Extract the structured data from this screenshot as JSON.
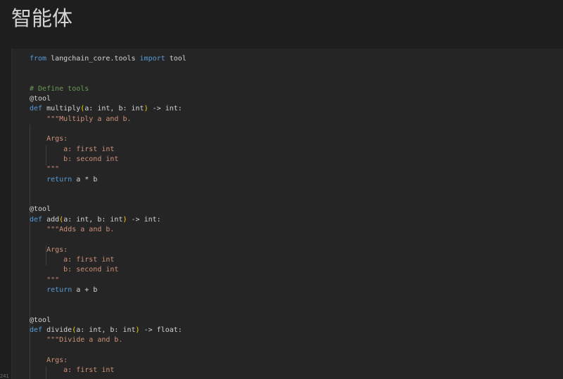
{
  "page": {
    "title": "智能体",
    "gutter_number": "241"
  },
  "code_cell": {
    "language": "python",
    "lines": [
      [
        {
          "t": "kw",
          "v": "from"
        },
        {
          "t": "tx",
          "v": " langchain_core.tools "
        },
        {
          "t": "kw",
          "v": "import"
        },
        {
          "t": "tx",
          "v": " tool"
        }
      ],
      [],
      [],
      [
        {
          "t": "cm",
          "v": "# Define tools"
        }
      ],
      [
        {
          "t": "tx",
          "v": "@tool"
        }
      ],
      [
        {
          "t": "kw",
          "v": "def"
        },
        {
          "t": "tx",
          "v": " multiply"
        },
        {
          "t": "pr",
          "v": "("
        },
        {
          "t": "tx",
          "v": "a: int, b: int"
        },
        {
          "t": "pr",
          "v": ")"
        },
        {
          "t": "tx",
          "v": " -> int:"
        }
      ],
      [
        {
          "t": "tx",
          "v": "    "
        },
        {
          "t": "st",
          "v": "\"\"\"Multiply a and b."
        }
      ],
      [],
      [
        {
          "t": "st",
          "v": "    Args:"
        }
      ],
      [
        {
          "t": "st",
          "v": "        a: first int"
        }
      ],
      [
        {
          "t": "st",
          "v": "        b: second int"
        }
      ],
      [
        {
          "t": "st",
          "v": "    \"\"\""
        }
      ],
      [
        {
          "t": "tx",
          "v": "    "
        },
        {
          "t": "kw",
          "v": "return"
        },
        {
          "t": "tx",
          "v": " a * b"
        }
      ],
      [],
      [],
      [
        {
          "t": "tx",
          "v": "@tool"
        }
      ],
      [
        {
          "t": "kw",
          "v": "def"
        },
        {
          "t": "tx",
          "v": " add"
        },
        {
          "t": "pr",
          "v": "("
        },
        {
          "t": "tx",
          "v": "a: int, b: int"
        },
        {
          "t": "pr",
          "v": ")"
        },
        {
          "t": "tx",
          "v": " -> int:"
        }
      ],
      [
        {
          "t": "tx",
          "v": "    "
        },
        {
          "t": "st",
          "v": "\"\"\"Adds a and b."
        }
      ],
      [],
      [
        {
          "t": "st",
          "v": "    Args:"
        }
      ],
      [
        {
          "t": "st",
          "v": "        a: first int"
        }
      ],
      [
        {
          "t": "st",
          "v": "        b: second int"
        }
      ],
      [
        {
          "t": "st",
          "v": "    \"\"\""
        }
      ],
      [
        {
          "t": "tx",
          "v": "    "
        },
        {
          "t": "kw",
          "v": "return"
        },
        {
          "t": "tx",
          "v": " a + b"
        }
      ],
      [],
      [],
      [
        {
          "t": "tx",
          "v": "@tool"
        }
      ],
      [
        {
          "t": "kw",
          "v": "def"
        },
        {
          "t": "tx",
          "v": " divide"
        },
        {
          "t": "pr",
          "v": "("
        },
        {
          "t": "tx",
          "v": "a: int, b: int"
        },
        {
          "t": "pr",
          "v": ")"
        },
        {
          "t": "tx",
          "v": " -> float:"
        }
      ],
      [
        {
          "t": "tx",
          "v": "    "
        },
        {
          "t": "st",
          "v": "\"\"\"Divide a and b."
        }
      ],
      [],
      [
        {
          "t": "st",
          "v": "    Args:"
        }
      ],
      [
        {
          "t": "st",
          "v": "        a: first int"
        }
      ]
    ]
  },
  "colors": {
    "background": "#1e1e1f",
    "cell_background": "#252526",
    "keyword": "#569cd6",
    "comment": "#6a9955",
    "string": "#ce9178",
    "function": "#dcdcaa",
    "paren": "#ffd700",
    "text": "#d4d4d4"
  }
}
